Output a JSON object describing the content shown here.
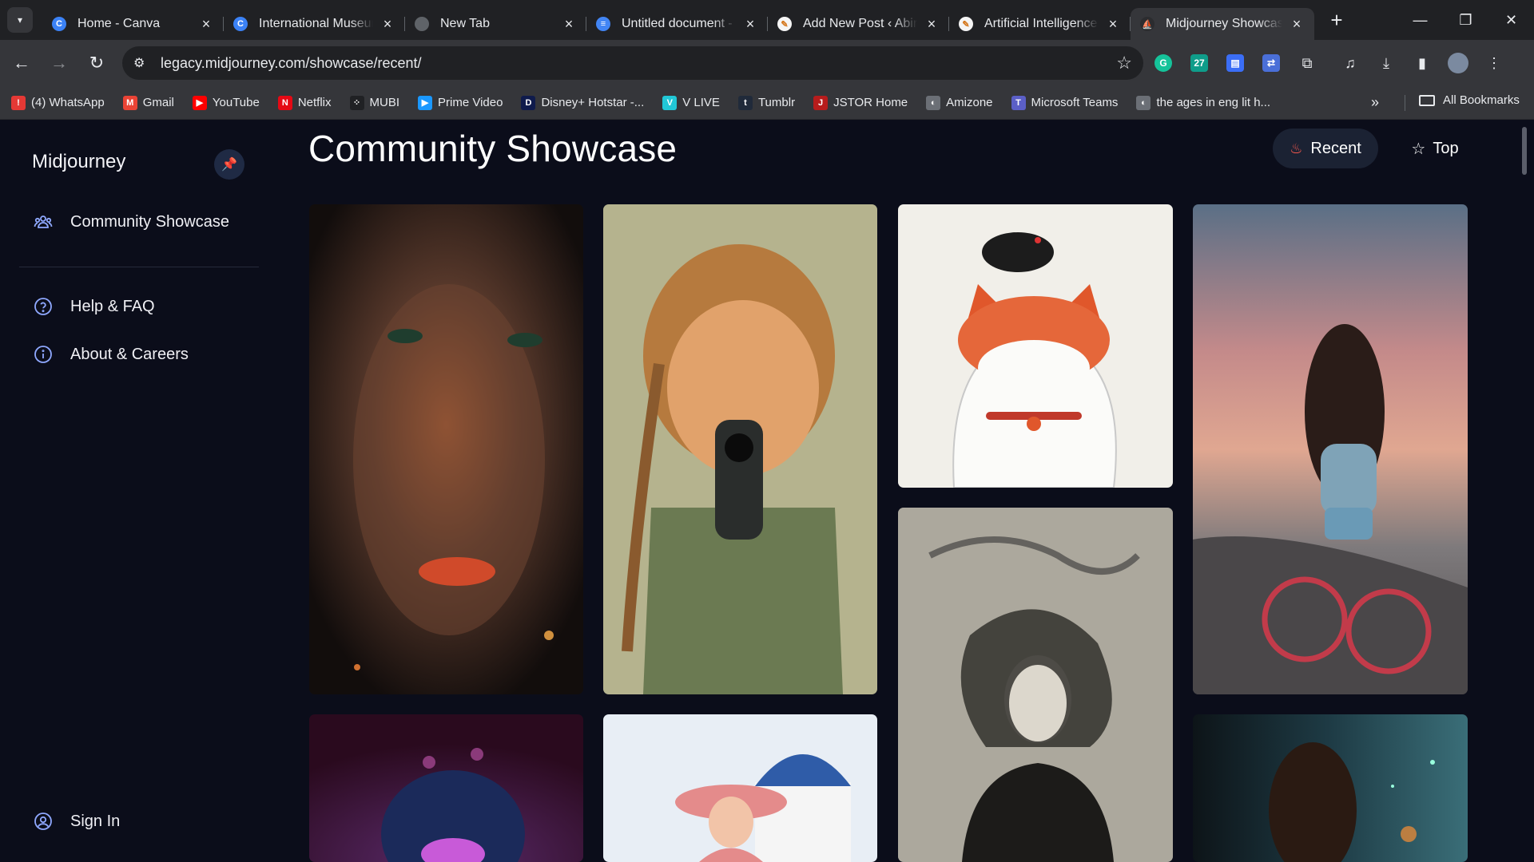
{
  "browser": {
    "tabs": [
      {
        "title": "Home - Canva",
        "favicon_color": "#3b82f6",
        "favicon_letter": "C"
      },
      {
        "title": "International Museum",
        "favicon_color": "#3b82f6",
        "favicon_letter": "C"
      },
      {
        "title": "New Tab",
        "favicon_color": "#5f6368",
        "favicon_letter": ""
      },
      {
        "title": "Untitled document - ",
        "favicon_color": "#4285f4",
        "favicon_letter": "≡"
      },
      {
        "title": "Add New Post ‹ Abir",
        "favicon_color": "#f5f5f5",
        "favicon_letter": "✎"
      },
      {
        "title": "Artificial Intelligence",
        "favicon_color": "#f5f5f5",
        "favicon_letter": "✎"
      },
      {
        "title": "Midjourney Showcase",
        "favicon_color": "#2b2c2f",
        "favicon_letter": "⛵"
      }
    ],
    "url": "legacy.midjourney.com/showcase/recent/",
    "bookmarks": [
      {
        "label": "(4) WhatsApp",
        "color": "#e53935",
        "glyph": "!"
      },
      {
        "label": "Gmail",
        "color": "#ea4335",
        "glyph": "M"
      },
      {
        "label": "YouTube",
        "color": "#ff0000",
        "glyph": "▶"
      },
      {
        "label": "Netflix",
        "color": "#e50914",
        "glyph": "N"
      },
      {
        "label": "MUBI",
        "color": "#202124",
        "glyph": "⁘"
      },
      {
        "label": "Prime Video",
        "color": "#1a98ff",
        "glyph": "▶"
      },
      {
        "label": "Disney+ Hotstar -...",
        "color": "#0f1b4c",
        "glyph": "D"
      },
      {
        "label": "V LIVE",
        "color": "#21c7d6",
        "glyph": "V"
      },
      {
        "label": "Tumblr",
        "color": "#202a3a",
        "glyph": "t"
      },
      {
        "label": "JSTOR Home",
        "color": "#b71c1c",
        "glyph": "J"
      },
      {
        "label": "Amizone",
        "color": "#6b6f76",
        "glyph": "◐"
      },
      {
        "label": "Microsoft Teams",
        "color": "#5b5fc7",
        "glyph": "T"
      },
      {
        "label": "the ages in eng lit h...",
        "color": "#6b6f76",
        "glyph": "◐"
      }
    ],
    "all_bookmarks": "All Bookmarks"
  },
  "sidebar": {
    "brand": "Midjourney",
    "items": [
      {
        "label": "Community Showcase",
        "icon": "users-icon"
      },
      {
        "label": "Help & FAQ",
        "icon": "help-icon"
      },
      {
        "label": "About & Careers",
        "icon": "info-icon"
      }
    ],
    "sign_in": "Sign In"
  },
  "main": {
    "title": "Community Showcase",
    "filters": {
      "recent": "Recent",
      "top": "Top"
    },
    "accent": "#ff5a4f"
  }
}
